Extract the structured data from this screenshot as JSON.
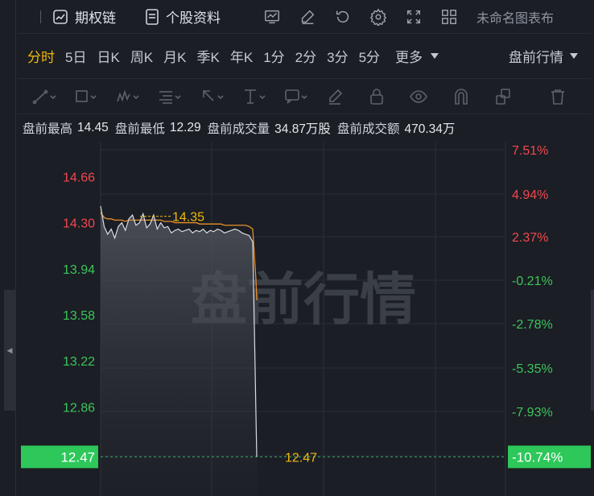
{
  "topbar": {
    "option_chain": "期权链",
    "stock_info": "个股资料",
    "chart_name": "未命名图表布",
    "tool_icons": [
      "chart-template-icon",
      "draw-pen-icon",
      "undo-icon",
      "settings-gear-icon",
      "fullscreen-icon",
      "layout-grid-icon"
    ]
  },
  "periods": {
    "tabs": [
      "分时",
      "5日",
      "日K",
      "周K",
      "月K",
      "季K",
      "年K",
      "1分",
      "2分",
      "3分",
      "5分"
    ],
    "active": "分时",
    "more": "更多",
    "session": "盘前行情"
  },
  "stats": {
    "high_label": "盘前最高",
    "high_value": "14.45",
    "low_label": "盘前最低",
    "low_value": "12.29",
    "vol_label": "盘前成交量",
    "vol_value": "34.87万股",
    "amt_label": "盘前成交额",
    "amt_value": "470.34万"
  },
  "chart_data": {
    "type": "line",
    "watermark": "盘前行情",
    "price_ticks": [
      "14.66",
      "14.30",
      "13.94",
      "13.58",
      "13.22",
      "12.86"
    ],
    "price_tick_values": [
      14.66,
      14.3,
      13.94,
      13.58,
      13.22,
      12.86
    ],
    "pct_ticks": [
      "7.51%",
      "4.94%",
      "2.37%",
      "-0.21%",
      "-2.78%",
      "-5.35%",
      "-7.93%"
    ],
    "pct_tick_values": [
      7.51,
      4.94,
      2.37,
      -0.21,
      -2.78,
      -5.35,
      -7.93
    ],
    "current_price": "12.47",
    "current_pct": "-10.74%",
    "high_marker": "14.35",
    "low_marker": "12.47",
    "price_series": [
      14.43,
      14.27,
      14.21,
      14.25,
      14.18,
      14.27,
      14.3,
      14.24,
      14.33,
      14.36,
      14.28,
      14.3,
      14.37,
      14.26,
      14.29,
      14.36,
      14.25,
      14.3,
      14.26,
      14.27,
      14.22,
      14.24,
      14.25,
      14.23,
      14.24,
      14.25,
      14.22,
      14.24,
      14.23,
      14.25,
      14.22,
      14.24,
      14.23,
      14.25,
      14.24,
      14.22,
      14.23,
      14.24,
      14.25,
      14.24,
      14.22,
      14.21,
      14.2,
      14.15,
      13.5,
      12.8,
      12.47,
      12.47
    ],
    "avg_series": [
      14.38,
      14.34,
      14.33,
      14.33,
      14.32,
      14.32,
      14.32,
      14.31,
      14.32,
      14.32,
      14.32,
      14.32,
      14.32,
      14.32,
      14.32,
      14.32,
      14.32,
      14.32,
      14.31,
      14.31,
      14.31,
      14.3,
      14.3,
      14.3,
      14.3,
      14.3,
      14.3,
      14.3,
      14.29,
      14.29,
      14.29,
      14.29,
      14.29,
      14.29,
      14.29,
      14.28,
      14.28,
      14.28,
      14.28,
      14.28,
      14.28,
      14.28,
      14.27,
      14.25,
      14.05,
      13.85,
      13.7,
      13.7
    ],
    "y_range": [
      12.29,
      14.87
    ],
    "colors": {
      "price_line": "#d9dce2",
      "avg_line": "#e8902a",
      "up": "#f0484f",
      "down": "#3cc45a",
      "accent": "#f0b90b",
      "current_bg": "#2dc75a"
    }
  }
}
